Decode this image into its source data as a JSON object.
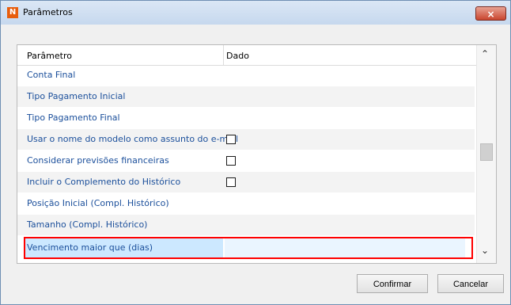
{
  "window": {
    "title": "Parâmetros",
    "close_symbol": "×"
  },
  "grid": {
    "headers": [
      "Parâmetro",
      "Dado"
    ],
    "rows": [
      {
        "label": "Conta Final",
        "checkbox": false
      },
      {
        "label": "Tipo Pagamento Inicial",
        "checkbox": false
      },
      {
        "label": "Tipo Pagamento Final",
        "checkbox": false
      },
      {
        "label": "Usar o nome do modelo como assunto do e-mail",
        "checkbox": true,
        "checked": false
      },
      {
        "label": "Considerar previsões financeiras",
        "checkbox": true,
        "checked": false
      },
      {
        "label": "Incluir o Complemento do Histórico",
        "checkbox": true,
        "checked": false
      },
      {
        "label": "Posição Inicial (Compl. Histórico)",
        "checkbox": false
      },
      {
        "label": "Tamanho (Compl. Histórico)",
        "checkbox": false
      },
      {
        "label": "Vencimento maior que (dias)",
        "checkbox": false,
        "selected": true,
        "value": ""
      }
    ]
  },
  "buttons": {
    "confirm": "Confirmar",
    "cancel": "Cancelar"
  },
  "icons": {
    "app": "app-icon",
    "close": "close-icon",
    "scroll_up": "chevron-up-icon",
    "scroll_down": "chevron-down-icon"
  },
  "colors": {
    "link_text": "#1b4f9b",
    "selected_row": "#cce8ff",
    "highlight_border": "#ff0000"
  }
}
